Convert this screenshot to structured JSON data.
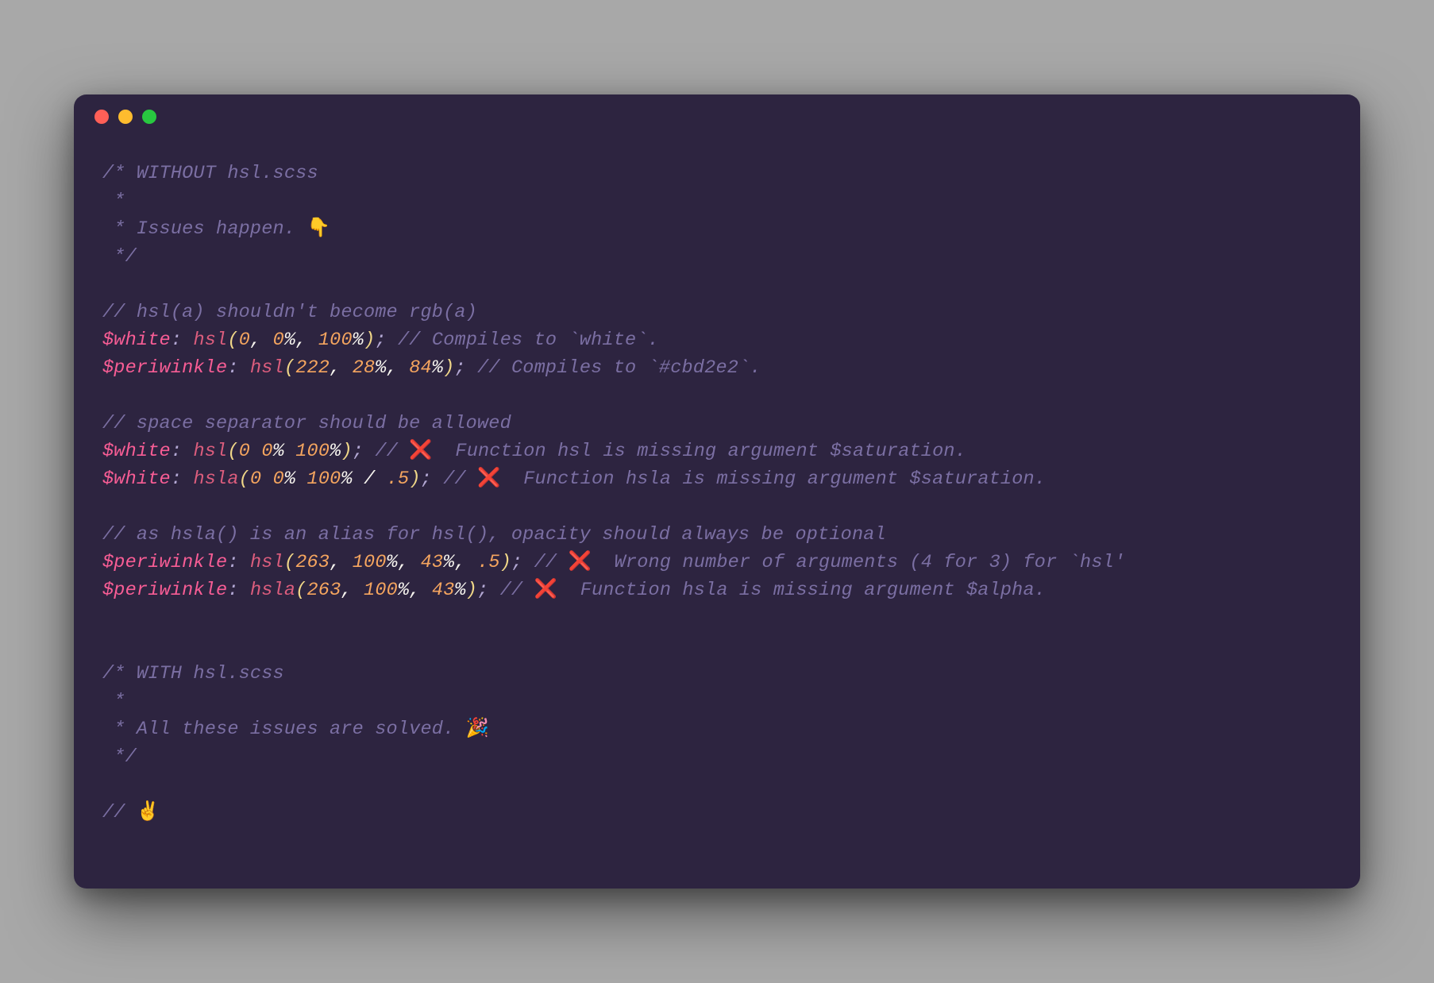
{
  "titlebar": {
    "dots": [
      "red",
      "yellow",
      "green"
    ]
  },
  "code": {
    "l1": "/* WITHOUT hsl.scss",
    "l2": " *",
    "l3a": " * Issues happen. ",
    "l3e": "👇",
    "l4": " */",
    "l5": "// hsl(a) shouldn't become rgb(a)",
    "l6_var": "$white",
    "l6_colon": ":",
    "l6_sp": " ",
    "l6_fn": "hsl",
    "l6_op": "(",
    "l6_a1": "0",
    "l6_c1": ", ",
    "l6_a2": "0",
    "l6_pct2": "%",
    "l6_c2": ", ",
    "l6_a3": "100",
    "l6_pct3": "%",
    "l6_cp": ")",
    "l6_semi": ";",
    "l6_cmt": " // Compiles to `white`.",
    "l7_var": "$periwinkle",
    "l7_fn": "hsl",
    "l7_a1": "222",
    "l7_a2": "28",
    "l7_a3": "84",
    "l7_cmt": " // Compiles to `#cbd2e2`.",
    "l8": "// space separator should be allowed",
    "l9_var": "$white",
    "l9_fn": "hsl",
    "l9_a1": "0",
    "l9_a2": "0",
    "l9_a3": "100",
    "l9_pre": " // ",
    "l9_emoji": "❌",
    "l9_cmt": "  Function hsl is missing argument $saturation.",
    "l10_var": "$white",
    "l10_fn": "hsla",
    "l10_a1": "0",
    "l10_a2": "0",
    "l10_a3": "100",
    "l10_slash": " / ",
    "l10_a4": ".5",
    "l10_pre": " // ",
    "l10_emoji": "❌",
    "l10_cmt": "  Function hsla is missing argument $saturation.",
    "l11": "// as hsla() is an alias for hsl(), opacity should always be optional",
    "l12_var": "$periwinkle",
    "l12_fn": "hsl",
    "l12_a1": "263",
    "l12_a2": "100",
    "l12_a3": "43",
    "l12_a4": ".5",
    "l12_pre": " // ",
    "l12_emoji": "❌",
    "l12_cmt": "  Wrong number of arguments (4 for 3) for `hsl'",
    "l13_var": "$periwinkle",
    "l13_fn": "hsla",
    "l13_a1": "263",
    "l13_a2": "100",
    "l13_a3": "43",
    "l13_pre": " // ",
    "l13_emoji": "❌",
    "l13_cmt": "  Function hsla is missing argument $alpha.",
    "l14": "/* WITH hsl.scss",
    "l15": " *",
    "l16a": " * All these issues are solved. ",
    "l16e": "🎉",
    "l17": " */",
    "l18a": "// ",
    "l18e": "✌️"
  }
}
